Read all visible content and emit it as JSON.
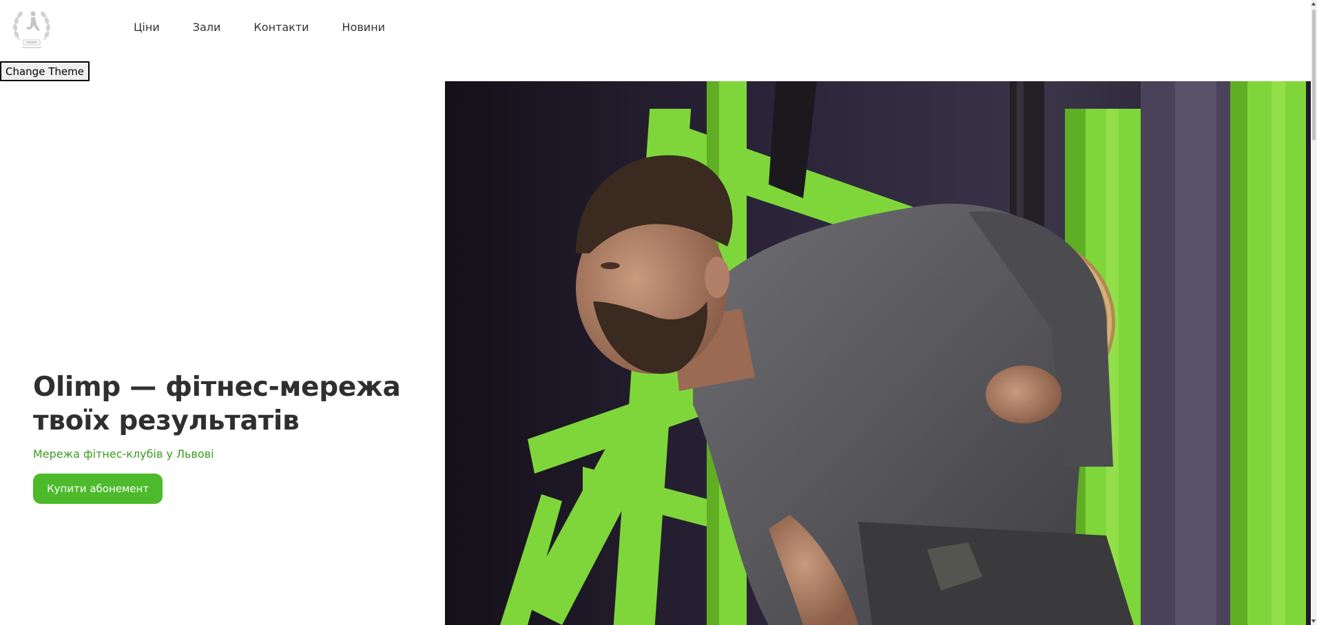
{
  "header": {
    "logo_icon": "olimp-laurel-logo-icon",
    "nav": [
      {
        "label": "Ціни"
      },
      {
        "label": "Зали"
      },
      {
        "label": "Контакти"
      },
      {
        "label": "Новини"
      }
    ]
  },
  "theme_button": {
    "label": "Change Theme"
  },
  "hero": {
    "title_line1": "Olimp — фітнес-мережа",
    "title_line2": "твоїх результатів",
    "subtitle": "Мережа фітнес-клубів у Львові",
    "cta_label": "Купити абонемент",
    "image_icon": "athlete-gymnastic-rings-photo"
  },
  "colors": {
    "accent": "#4cba2a",
    "subtitle": "#3a9a1f",
    "title": "#2f2f2f"
  }
}
